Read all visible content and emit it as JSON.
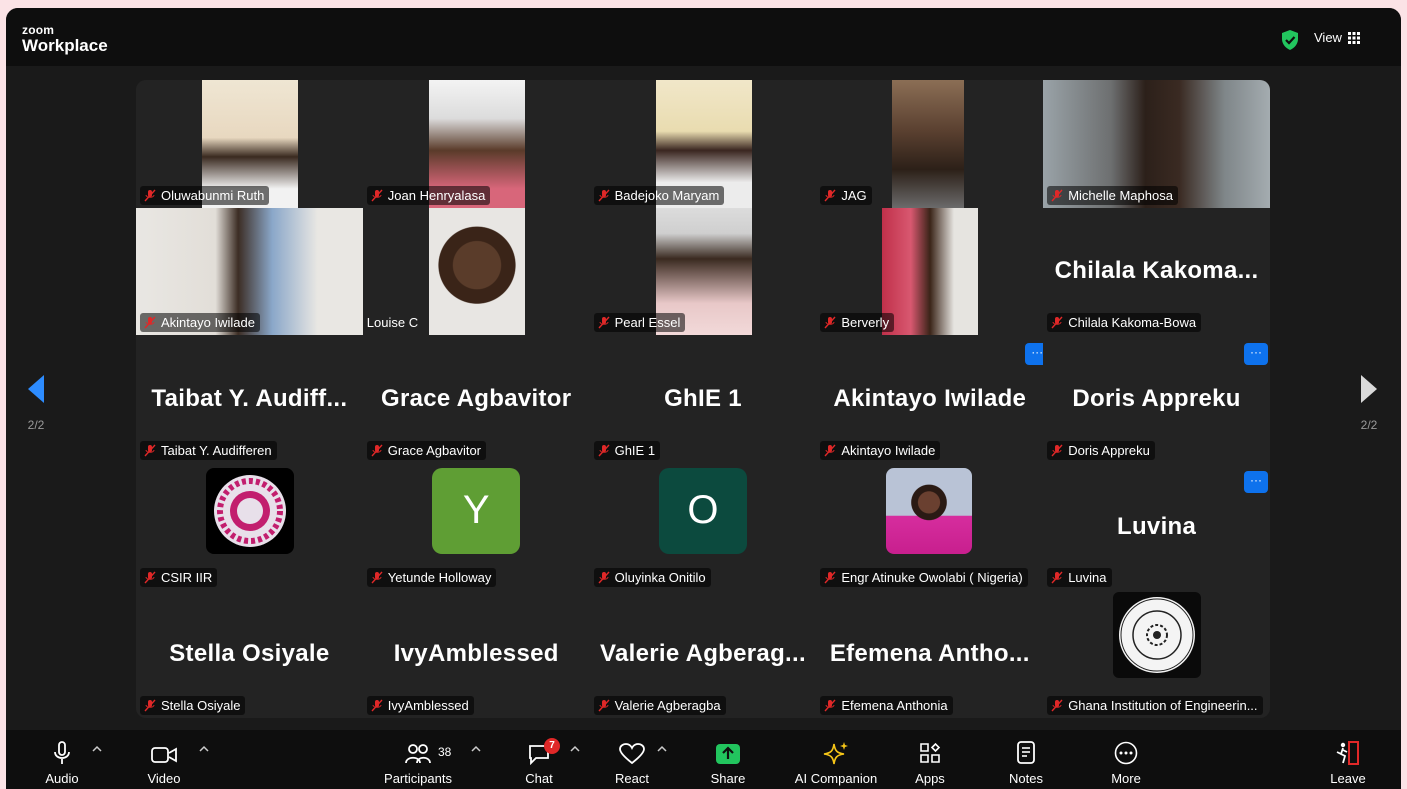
{
  "app": {
    "logo_top": "zoom",
    "logo_bottom": "Workplace",
    "view_label": "View"
  },
  "nav": {
    "page_indicator": "2/2"
  },
  "participants": [
    {
      "name": "Oluwabunmi Ruth"
    },
    {
      "name": "Joan Henryalasa"
    },
    {
      "name": "Badejoko Maryam"
    },
    {
      "name": "JAG"
    },
    {
      "name": "Michelle Maphosa"
    },
    {
      "name": "Akintayo Iwilade"
    },
    {
      "name": "Louise C"
    },
    {
      "name": "Pearl Essel"
    },
    {
      "name": "Berverly"
    },
    {
      "name": "Chilala Kakoma-Bowa",
      "display": "Chilala  Kakoma..."
    },
    {
      "name": "Taibat Y. Audifferen",
      "display": "Taibat  Y.  Audiff..."
    },
    {
      "name": "Grace Agbavitor",
      "display": "Grace Agbavitor"
    },
    {
      "name": "GhIE 1",
      "display": "GhIE 1"
    },
    {
      "name": "Akintayo Iwilade",
      "display": "Akintayo Iwilade"
    },
    {
      "name": "Doris Appreku",
      "display": "Doris Appreku"
    },
    {
      "name": "CSIR IIR"
    },
    {
      "name": "Yetunde Holloway",
      "initial": "Y"
    },
    {
      "name": "Oluyinka Onitilo",
      "initial": "O"
    },
    {
      "name": "Engr Atinuke Owolabi ( Nigeria)"
    },
    {
      "name": "Luvina",
      "display": "Luvina"
    },
    {
      "name": "Stella Osiyale",
      "display": "Stella Osiyale"
    },
    {
      "name": "IvyAmblessed",
      "display": "IvyAmblessed"
    },
    {
      "name": "Valerie Agberagba",
      "display": "Valerie  Agberag..."
    },
    {
      "name": "Efemena Anthonia",
      "display": "Efemena  Antho..."
    },
    {
      "name": "Ghana Institution of Engineerin..."
    }
  ],
  "toolbar": {
    "audio": "Audio",
    "video": "Video",
    "participants": "Participants",
    "participant_count": "38",
    "chat": "Chat",
    "chat_badge": "7",
    "react": "React",
    "share": "Share",
    "ai_companion": "AI Companion",
    "apps": "Apps",
    "notes": "Notes",
    "more": "More",
    "leave": "Leave"
  },
  "colors": {
    "accent_blue": "#0e72ed",
    "share_green": "#22c55e",
    "avatar_y": "#5f9e34",
    "avatar_o": "#0c4a3e",
    "leave_red": "#e02828"
  }
}
